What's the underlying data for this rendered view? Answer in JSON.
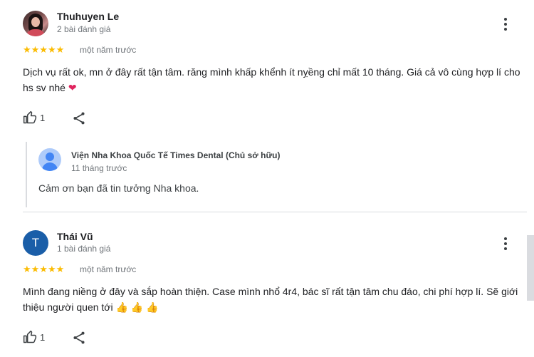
{
  "reviews": [
    {
      "author": "Thuhuyen Le",
      "review_count": "2 bài đánh giá",
      "stars": "★★★★★",
      "time": "một năm trước",
      "text": "Dịch vụ rất ok, mn ở đây rất tận tâm. răng mình khấp khểnh ít nỵềng chỉ mất 10 tháng. Giá cả vô cùng hợp lí cho hs sv nhé",
      "emoji": "❤",
      "likes": "1",
      "owner_reply": {
        "name": "Viện Nha Khoa Quốc Tế Times Dental (Chủ sở hữu)",
        "time": "11 tháng trước",
        "text": "Cảm ơn bạn đã tin tưởng Nha khoa."
      }
    },
    {
      "author": "Thái Vũ",
      "avatar_letter": "T",
      "review_count": "1 bài đánh giá",
      "stars": "★★★★★",
      "time": "một năm trước",
      "text": "Mình đang niềng ở đây và sắp hoàn thiện. Case mình nhổ 4r4, bác sĩ rất tận tâm chu đáo, chi phí hợp lí. Sẽ giới thiệu người quen tới",
      "emoji": "👍 👍 👍",
      "likes": "1"
    }
  ],
  "colors": {
    "star": "#fbbc04",
    "avatar_letter_bg": "#1a5ea8",
    "divider": "#dadce0"
  },
  "icons": {
    "like": "thumbs-up-icon",
    "share": "share-icon",
    "more": "more-vert-icon"
  }
}
